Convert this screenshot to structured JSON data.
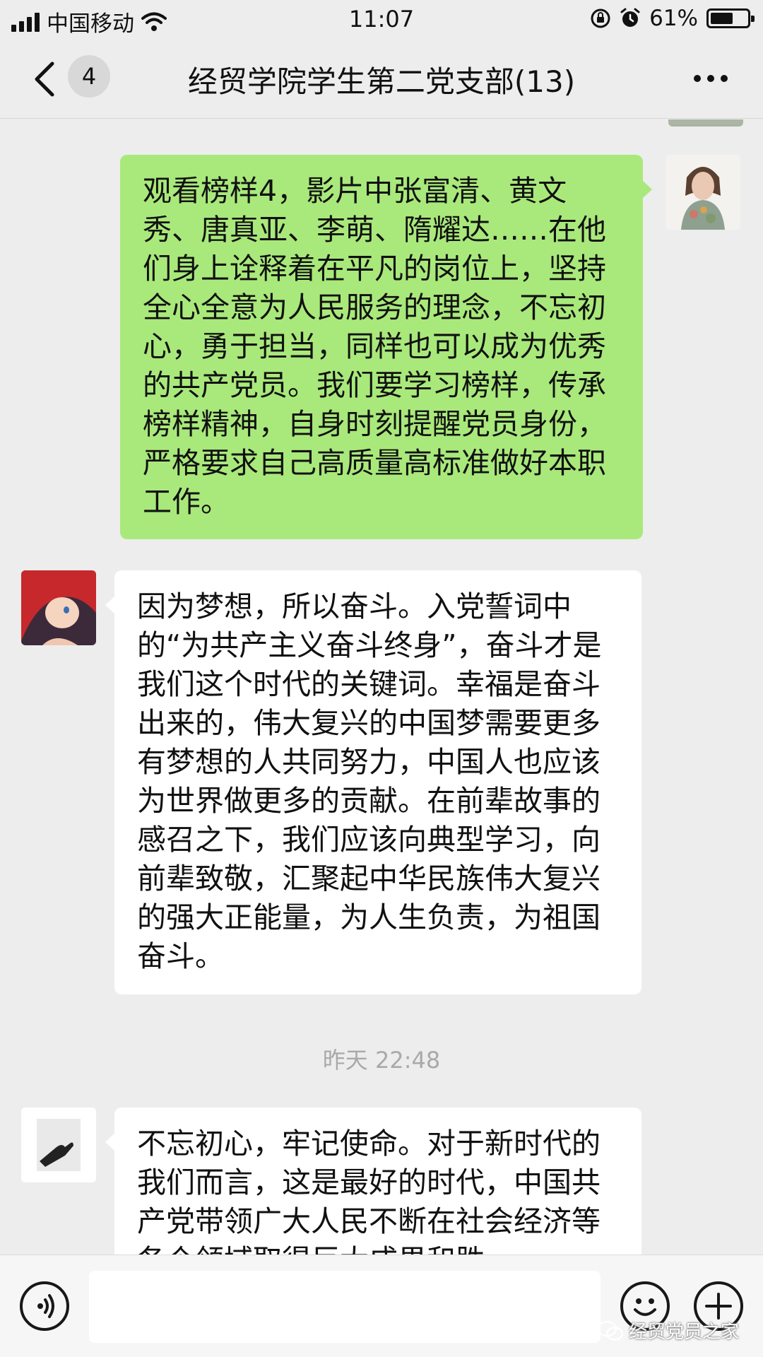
{
  "status_bar": {
    "carrier": "中国移动",
    "time": "11:07",
    "battery_percent": "61%",
    "battery_level": 0.61,
    "icons": [
      "signal-icon",
      "wifi-icon",
      "rotation-lock-icon",
      "alarm-icon",
      "battery-icon"
    ]
  },
  "nav": {
    "back_icon": "chevron-left-icon",
    "unread_count": "4",
    "title": "经贸学院学生第二党支部(13)",
    "more_icon": "more-dots-icon"
  },
  "messages": [
    {
      "side": "right",
      "text": "观看榜样4，影片中张富清、黄文秀、唐真亚、李萌、隋耀达……在他们身上诠释着在平凡的岗位上，坚持全心全意为人民服务的理念，不忘初心，勇于担当，同样也可以成为优秀的共产党员。我们要学习榜样，传承榜样精神，自身时刻提醒党员身份，严格要求自己高质量高标准做好本职工作。"
    },
    {
      "side": "left",
      "text": "因为梦想，所以奋斗。入党誓词中的“为共产主义奋斗终身”，奋斗才是我们这个时代的关键词。幸福是奋斗出来的，伟大复兴的中国梦需要更多有梦想的人共同努力，中国人也应该为世界做更多的贡献。在前辈故事的感召之下，我们应该向典型学习，向前辈致敬，汇聚起中华民族伟大复兴的强大正能量，为人生负责，为祖国奋斗。"
    },
    {
      "side": "left",
      "text": "不忘初心，牢记使命。对于新时代的我们而言，这是最好的时代，中国共产党带领广大人民不断在社会经济等各个领域取得巨大成果和胜"
    }
  ],
  "timestamp": "昨天 22:48",
  "input_bar": {
    "voice_icon": "voice-icon",
    "emoji_icon": "emoji-icon",
    "add_icon": "plus-icon",
    "message_value": ""
  },
  "watermark": "经贸党员之家",
  "colors": {
    "background": "#ededed",
    "sent_bubble": "#a9e97b",
    "received_bubble": "#ffffff",
    "timestamp_text": "#a9a9a9"
  }
}
